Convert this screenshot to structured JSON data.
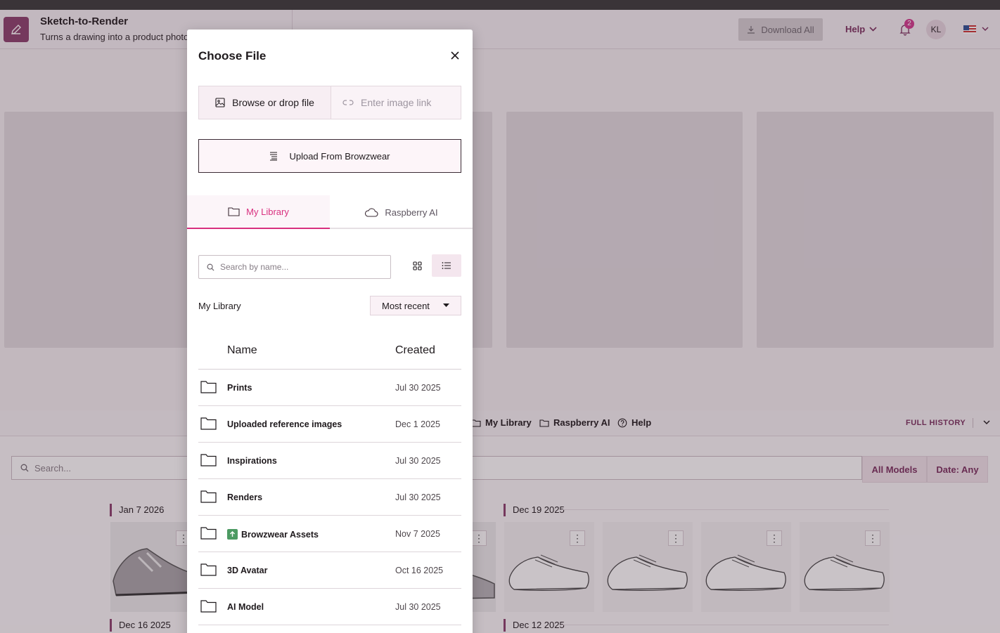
{
  "app": {
    "title": "Sketch-to-Render",
    "subtitle": "Turns a drawing into a product photo"
  },
  "header": {
    "download_all": "Download All",
    "help": "Help",
    "notification_count": "2",
    "avatar_initials": "KL"
  },
  "library_bar": {
    "my_library": "My Library",
    "raspberry_ai": "Raspberry AI",
    "help": "Help",
    "full_history": "FULL HISTORY"
  },
  "history": {
    "search_placeholder": "Search...",
    "all_models": "All Models",
    "date_filter": "Date: Any",
    "groups": [
      {
        "date": "Jan 7 2026"
      },
      {
        "date": "Dec 19 2025"
      },
      {
        "date": "Dec 16 2025"
      },
      {
        "date": "Dec 12 2025"
      }
    ]
  },
  "modal": {
    "title": "Choose File",
    "browse_label": "Browse or drop file",
    "link_placeholder": "Enter image link",
    "browzwear_label": "Upload From Browzwear",
    "tabs": [
      {
        "label": "My Library",
        "active": true
      },
      {
        "label": "Raspberry AI",
        "active": false
      }
    ],
    "search_placeholder": "Search by name...",
    "section_heading": "My Library",
    "sort_label": "Most recent",
    "columns": {
      "name": "Name",
      "created": "Created"
    },
    "rows": [
      {
        "name": "Prints",
        "created": "Jul 30 2025"
      },
      {
        "name": "Uploaded reference images",
        "created": "Dec 1 2025"
      },
      {
        "name": "Inspirations",
        "created": "Jul 30 2025"
      },
      {
        "name": "Renders",
        "created": "Jul 30 2025"
      },
      {
        "name": "Browzwear Assets",
        "created": "Nov 7 2025"
      },
      {
        "name": "3D Avatar",
        "created": "Oct 16 2025"
      },
      {
        "name": "AI Model",
        "created": "Jul 30 2025"
      }
    ]
  },
  "colors": {
    "brand": "#8b3f6c",
    "accent_pink": "#d8307f",
    "badge": "#d23a8e"
  }
}
